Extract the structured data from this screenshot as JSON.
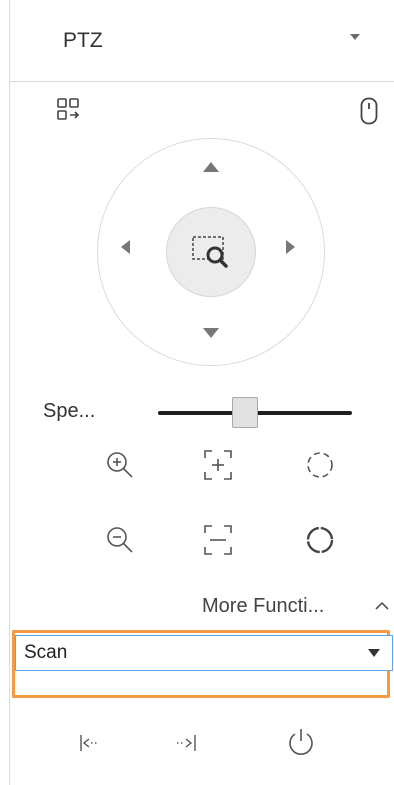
{
  "header": {
    "title": "PTZ",
    "dropdown_icon": "caret-down-icon"
  },
  "toolbar": {
    "left_icon": "grid-switch-icon",
    "right_icon": "mouse-icon"
  },
  "ptz_control": {
    "directions": [
      "up",
      "down",
      "left",
      "right"
    ],
    "center_icon": "zoom-to-area-icon"
  },
  "speed": {
    "label": "Spe...",
    "level_fraction": 0.45
  },
  "zoom_buttons": [
    {
      "icon": "zoom-in-icon"
    },
    {
      "icon": "focus-near-icon"
    },
    {
      "icon": "iris-open-icon"
    },
    {
      "icon": "zoom-out-icon"
    },
    {
      "icon": "focus-far-icon"
    },
    {
      "icon": "iris-close-icon"
    }
  ],
  "more_functions": {
    "label": "More Functi...",
    "toggle_icon": "chevron-up-icon"
  },
  "function_select": {
    "selected": "Scan"
  },
  "bottom_controls": [
    {
      "icon": "set-left-limit-icon"
    },
    {
      "icon": "set-right-limit-icon"
    },
    {
      "icon": "power-icon"
    }
  ],
  "colors": {
    "highlight": "#f39a43",
    "select_border": "#59a7e8",
    "icon_gray": "#555555"
  }
}
